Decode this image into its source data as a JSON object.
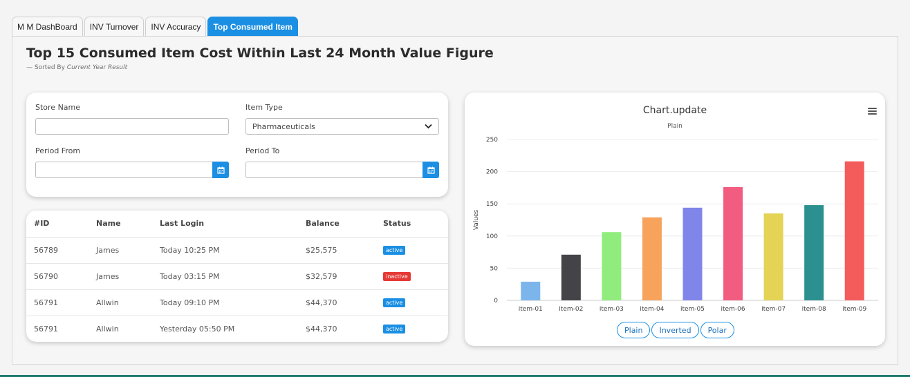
{
  "tabs": [
    {
      "label": "M M DashBoard"
    },
    {
      "label": "INV Turnover"
    },
    {
      "label": "INV Accuracy"
    },
    {
      "label": "Top Consumed Item"
    }
  ],
  "header": {
    "title": "Top 15 Consumed Item Cost Within Last 24 Month Value Figure",
    "subtitle_prefix": "— Sorted By",
    "subtitle_em": "Current Year Result"
  },
  "filters": {
    "store_name": {
      "label": "Store Name",
      "value": ""
    },
    "item_type": {
      "label": "Item Type",
      "value": "Pharmaceuticals"
    },
    "period_from": {
      "label": "Period From",
      "value": ""
    },
    "period_to": {
      "label": "Period To",
      "value": ""
    }
  },
  "table": {
    "headers": [
      "#ID",
      "Name",
      "Last Login",
      "Balance",
      "Status"
    ],
    "rows": [
      {
        "id": "56789",
        "name": "James",
        "last_login": "Today 10:25 PM",
        "balance": "$25,575",
        "status": "active"
      },
      {
        "id": "56790",
        "name": "James",
        "last_login": "Today 03:15 PM",
        "balance": "$32,579",
        "status": "inactive"
      },
      {
        "id": "56791",
        "name": "Allwin",
        "last_login": "Today 09:10 PM",
        "balance": "$44,370",
        "status": "active"
      },
      {
        "id": "56791",
        "name": "Allwin",
        "last_login": "Yesterday 05:50 PM",
        "balance": "$44,370",
        "status": "active"
      }
    ]
  },
  "colors": {
    "accent": "#1a8fe3",
    "status_active": "#1a8fe3",
    "status_inactive": "#e53935"
  },
  "chart_buttons": [
    "Plain",
    "Inverted",
    "Polar"
  ],
  "chart_data": {
    "type": "bar",
    "title": "Chart.update",
    "subtitle": "Plain",
    "ylabel": "Values",
    "xlabel": "",
    "categories": [
      "item-01",
      "item-02",
      "item-03",
      "item-04",
      "item-05",
      "item-06",
      "item-07",
      "item-08",
      "item-09"
    ],
    "values": [
      29,
      71,
      106,
      129,
      144,
      176,
      135,
      148,
      216
    ],
    "colors": [
      "#7cb5ec",
      "#434348",
      "#90ed7d",
      "#f7a35c",
      "#8085e9",
      "#f15c80",
      "#e4d354",
      "#2b908f",
      "#f45b5b"
    ],
    "ylim": [
      0,
      250
    ],
    "yticks": [
      0,
      50,
      100,
      150,
      200,
      250
    ],
    "grid": true,
    "legend": "none"
  }
}
